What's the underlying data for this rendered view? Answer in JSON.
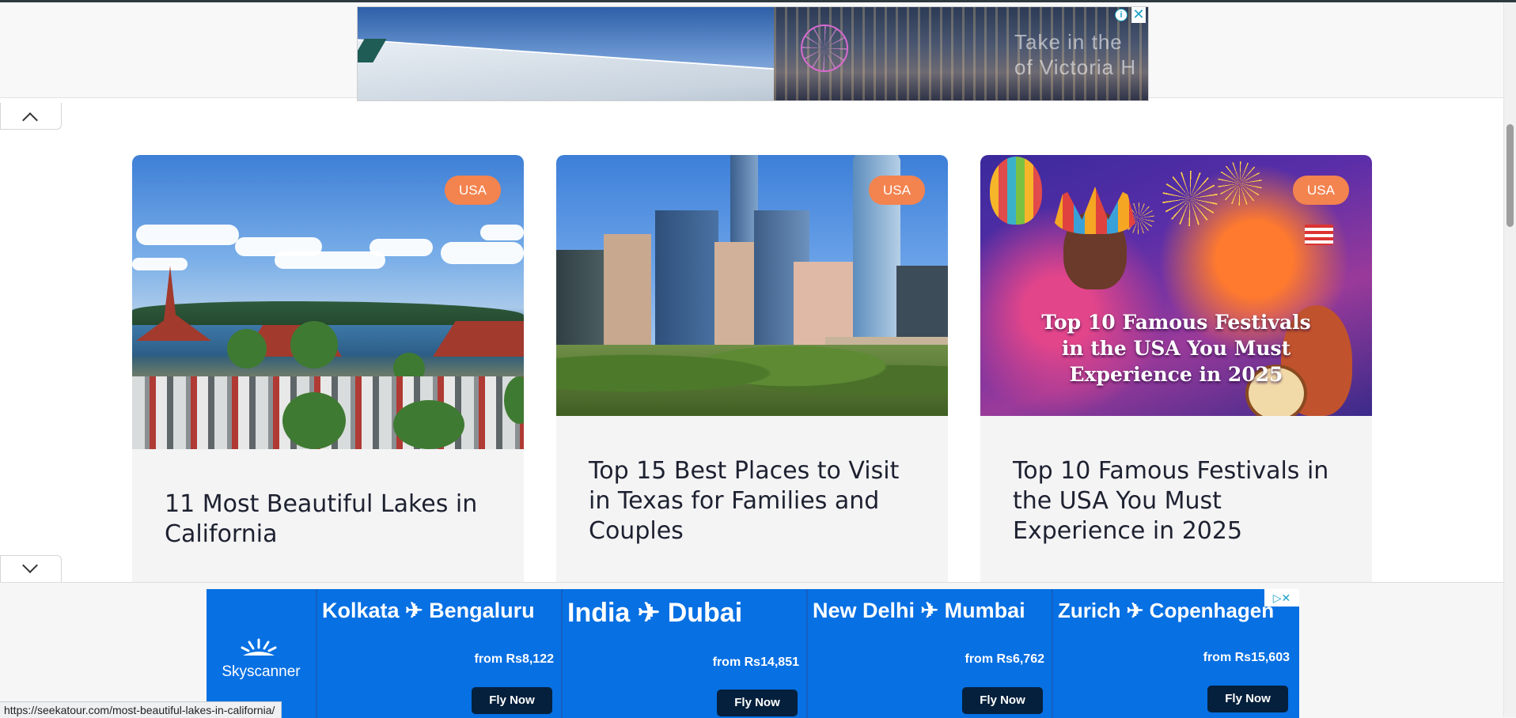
{
  "top_ad": {
    "text_line1": "Take in the",
    "text_line2": "of Victoria H",
    "info_symbol": "i",
    "close_symbol": "✕"
  },
  "cards": [
    {
      "badge": "USA",
      "title": "11 Most Beautiful Lakes in California",
      "image": "lakes-california-photo"
    },
    {
      "badge": "USA",
      "title": "Top 15 Best Places to Visit in Texas for Families and Couples",
      "image": "texas-city-skyline-photo"
    },
    {
      "badge": "USA",
      "title": "Top 10 Famous Festivals in the USA You Must Experience in 2025",
      "image": "festivals-illustration",
      "image_text_lines": [
        "Top 10 Famous Festivals",
        "in the USA You Must",
        "Experience in 2025"
      ]
    }
  ],
  "bottom_ad": {
    "brand": "Skyscanner",
    "adchoices_symbol": "▷✕",
    "routes": [
      {
        "title": "Kolkata ✈ Bengaluru",
        "price": "from Rs8,122",
        "cta": "Fly Now"
      },
      {
        "title": "India ✈ Dubai",
        "price": "from Rs14,851",
        "cta": "Fly Now"
      },
      {
        "title": "New Delhi ✈ Mumbai",
        "price": "from Rs6,762",
        "cta": "Fly Now"
      },
      {
        "title": "Zurich ✈ Copenhagen",
        "price": "from Rs15,603",
        "cta": "Fly Now"
      }
    ]
  },
  "status_bar": {
    "url": "https://seekatour.com/most-beautiful-lakes-in-california/"
  },
  "colors": {
    "badge": "#f3834f",
    "card_bg": "#f4f4f5",
    "ad_blue": "#0770e3",
    "button_navy": "#05203c"
  }
}
